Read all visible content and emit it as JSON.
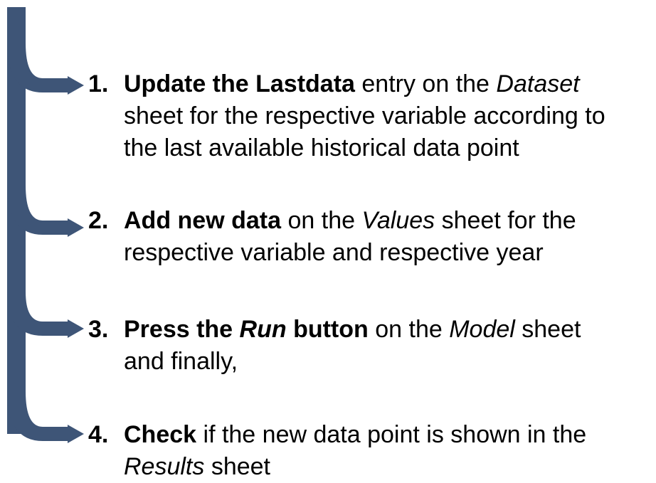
{
  "colors": {
    "arrow": "#3e5577",
    "arrow_edge": "#2c3f5c",
    "text": "#000000"
  },
  "steps": [
    {
      "number": "1.",
      "line1": [
        {
          "text": "Update the Lastdata",
          "style": "bold"
        },
        {
          "text": " entry on the ",
          "style": "normal"
        },
        {
          "text": "Dataset",
          "style": "italic"
        }
      ],
      "line2": "sheet for the respective variable according to",
      "line3": "the last available historical data point"
    },
    {
      "number": "2.",
      "line1": [
        {
          "text": "Add new data",
          "style": "bold"
        },
        {
          "text": " on the ",
          "style": "normal"
        },
        {
          "text": "Values",
          "style": "italic"
        },
        {
          "text": " sheet for the",
          "style": "normal"
        }
      ],
      "line2": "respective variable and respective year"
    },
    {
      "number": "3.",
      "line1": [
        {
          "text": "Press the ",
          "style": "bold"
        },
        {
          "text": "Run",
          "style": "bold-italic"
        },
        {
          "text": " button",
          "style": "bold"
        },
        {
          "text": " on the ",
          "style": "normal"
        },
        {
          "text": "Model",
          "style": "italic"
        },
        {
          "text": " sheet",
          "style": "normal"
        }
      ],
      "line2": "and finally,"
    },
    {
      "number": "4.",
      "line1": [
        {
          "text": "Check",
          "style": "bold"
        },
        {
          "text": " if the new data point is shown in the",
          "style": "normal"
        }
      ],
      "line2_parts": [
        {
          "text": "Results",
          "style": "italic"
        },
        {
          "text": " sheet",
          "style": "normal"
        }
      ]
    }
  ]
}
